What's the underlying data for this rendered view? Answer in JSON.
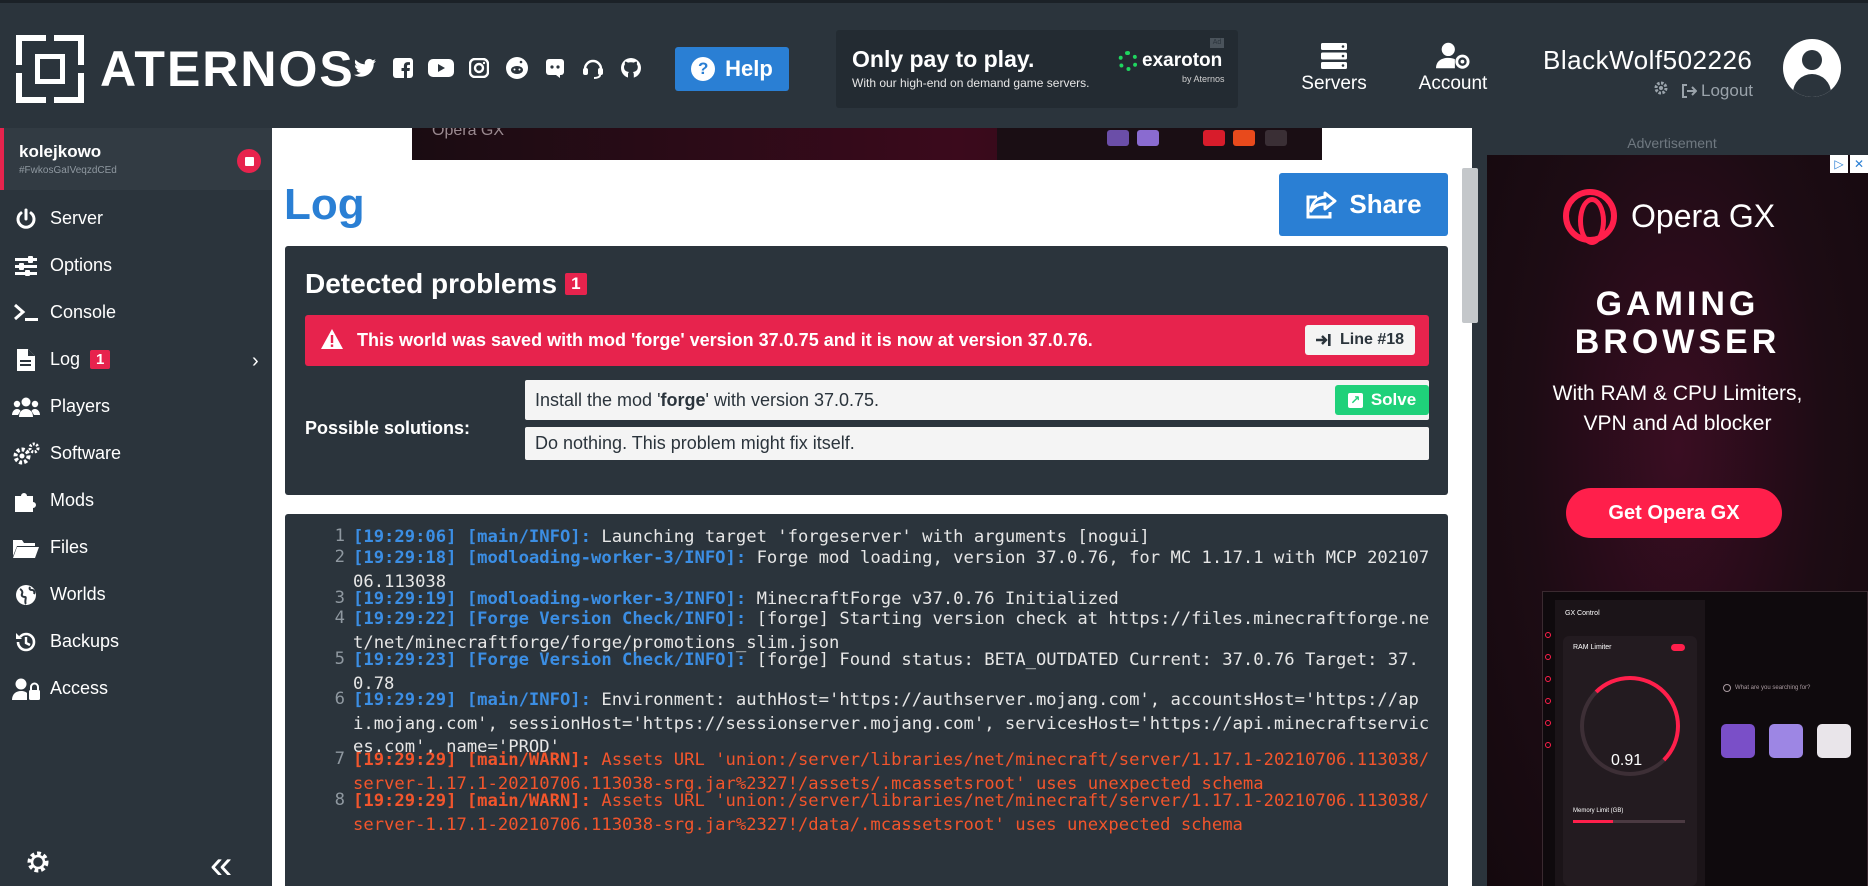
{
  "header": {
    "logo_text": "ATERNOS",
    "socials": [
      "twitter-icon",
      "facebook-icon",
      "youtube-icon",
      "instagram-icon",
      "reddit-icon",
      "discord-icon",
      "support-icon",
      "github-icon"
    ],
    "help_label": "Help",
    "promo": {
      "title": "Only pay to play.",
      "subtitle": "With our high-end on demand game servers.",
      "brand": "exaroton",
      "brand_by": "by Aternos",
      "ad_badge": "Ad"
    },
    "nav": {
      "servers": "Servers",
      "account": "Account"
    },
    "user": {
      "name": "BlackWolf502226",
      "logout": "Logout"
    }
  },
  "sidebar": {
    "server": {
      "name": "kolejkowo",
      "id": "#FwkosGaIVeqzdCEd"
    },
    "items": [
      {
        "label": "Server",
        "icon": "power-icon"
      },
      {
        "label": "Options",
        "icon": "sliders-icon"
      },
      {
        "label": "Console",
        "icon": "terminal-icon"
      },
      {
        "label": "Log",
        "icon": "file-icon",
        "badge": "1"
      },
      {
        "label": "Players",
        "icon": "users-icon"
      },
      {
        "label": "Software",
        "icon": "cogs-icon"
      },
      {
        "label": "Mods",
        "icon": "puzzle-icon"
      },
      {
        "label": "Files",
        "icon": "folder-icon"
      },
      {
        "label": "Worlds",
        "icon": "globe-icon"
      },
      {
        "label": "Backups",
        "icon": "history-icon"
      },
      {
        "label": "Access",
        "icon": "user-lock-icon"
      }
    ]
  },
  "main": {
    "top_ad_text": "Opera GX",
    "title": "Log",
    "share_label": "Share",
    "problems": {
      "heading": "Detected problems",
      "count": "1",
      "alert": "This world was saved with mod 'forge' version 37.0.75 and it is now at version 37.0.76.",
      "line_label": "Line #18",
      "solutions_label": "Possible solutions:",
      "solution1_pre": "Install the mod '",
      "solution1_bold": "forge",
      "solution1_post": "' with version 37.0.75.",
      "solve_label": "Solve",
      "solution2": "Do nothing. This problem might fix itself."
    },
    "log": [
      {
        "n": "1",
        "tag": "[19:29:06] [main/INFO]:",
        "msg": " Launching target 'forgeserver' with arguments [nogui]",
        "warn": false
      },
      {
        "n": "2",
        "tag": "[19:29:18] [modloading-worker-3/INFO]:",
        "msg": " Forge mod loading, version 37.0.76, for MC 1.17.1 with MCP 20210706.113038",
        "warn": false
      },
      {
        "n": "3",
        "tag": "[19:29:19] [modloading-worker-3/INFO]:",
        "msg": " MinecraftForge v37.0.76 Initialized",
        "warn": false
      },
      {
        "n": "4",
        "tag": "[19:29:22] [Forge Version Check/INFO]:",
        "msg": " [forge] Starting version check at https://files.minecraftforge.net/net/minecraftforge/forge/promotions_slim.json",
        "warn": false
      },
      {
        "n": "5",
        "tag": "[19:29:23] [Forge Version Check/INFO]:",
        "msg": " [forge] Found status: BETA_OUTDATED Current: 37.0.76 Target: 37.0.78",
        "warn": false
      },
      {
        "n": "6",
        "tag": "[19:29:29] [main/INFO]:",
        "msg": " Environment: authHost='https://authserver.mojang.com', accountsHost='https://api.mojang.com', sessionHost='https://sessionserver.mojang.com', servicesHost='https://api.minecraftservices.com', name='PROD'",
        "warn": false
      },
      {
        "n": "7",
        "tag": "[19:29:29] [main/WARN]:",
        "msg": " Assets URL 'union:/server/libraries/net/minecraft/server/1.17.1-20210706.113038/server-1.17.1-20210706.113038-srg.jar%2327!/assets/.mcassetsroot' uses unexpected schema",
        "warn": true
      },
      {
        "n": "8",
        "tag": "[19:29:29] [main/WARN]:",
        "msg": " Assets URL 'union:/server/libraries/net/minecraft/server/1.17.1-20210706.113038/server-1.17.1-20210706.113038-srg.jar%2327!/data/.mcassetsroot' uses unexpected schema",
        "warn": true
      }
    ]
  },
  "right_ad": {
    "label": "Advertisement",
    "brand": "Opera GX",
    "headline_1": "GAMING",
    "headline_2": "BROWSER",
    "sub_1": "With RAM & CPU Limiters,",
    "sub_2": "VPN and Ad blocker",
    "cta": "Get Opera GX",
    "panel_title": "GX Control",
    "panel_limiter": "RAM Limiter",
    "panel_value": "0.91",
    "panel_memory": "Memory Limit (GB)",
    "search_placeholder": "What are you searching for?"
  },
  "colors": {
    "accent": "#2a7fd4",
    "danger": "#e7234d",
    "success": "#1fd17a",
    "bg": "#2b343c",
    "warn_text": "#f2552c"
  }
}
